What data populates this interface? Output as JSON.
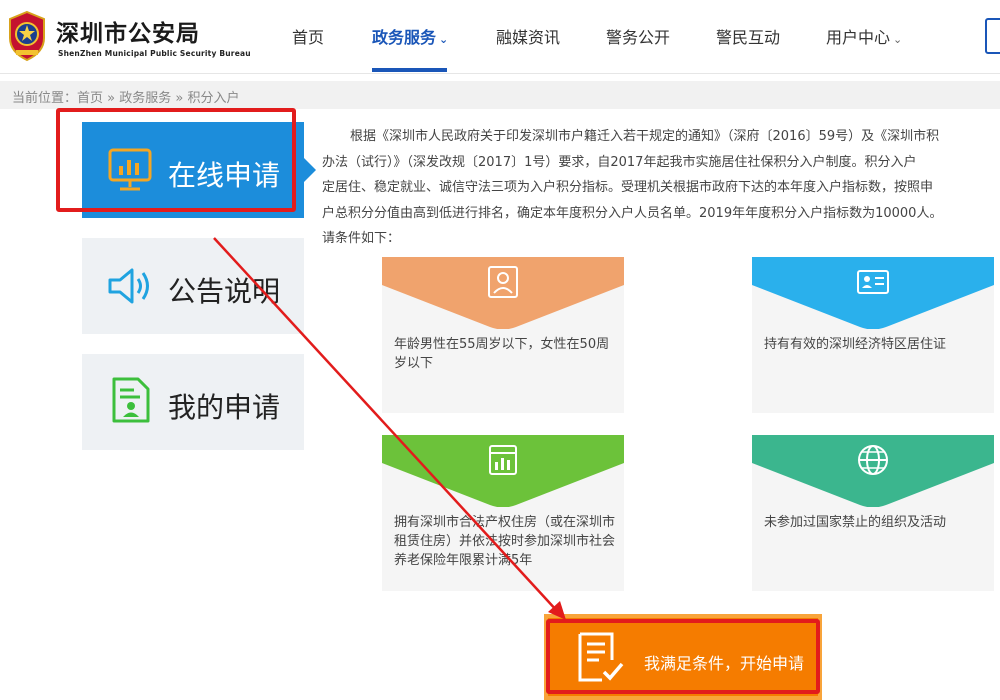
{
  "header": {
    "logo_title": "深圳市公安局",
    "logo_subtitle": "ShenZhen Municipal Public Security Bureau",
    "nav": [
      {
        "label": "首页"
      },
      {
        "label": "政务服务",
        "active": true
      },
      {
        "label": "融媒资讯"
      },
      {
        "label": "警务公开"
      },
      {
        "label": "警民互动"
      },
      {
        "label": "用户中心"
      }
    ]
  },
  "breadcrumb": {
    "prefix": "当前位置：",
    "items": [
      "首页",
      "政务服务",
      "积分入户"
    ],
    "separator": " » "
  },
  "sidebar": {
    "items": [
      {
        "label": "在线申请",
        "icon": "presentation-chart-icon",
        "active": true
      },
      {
        "label": "公告说明",
        "icon": "speaker-icon"
      },
      {
        "label": "我的申请",
        "icon": "document-user-icon"
      }
    ]
  },
  "intro": {
    "lines": [
      "根据《深圳市人民政府关于印发深圳市户籍迁入若干规定的通知》（深府〔2016〕59号）及《深圳市积",
      "办法（试行）》（深发改规〔2017〕1号）要求，自2017年起我市实施居住社保积分入户制度。积分入户",
      "定居住、稳定就业、诚信守法三项为入户积分指标。受理机关根据市政府下达的本年度入户指标数，按照申",
      "户总积分分值由高到低进行排名，确定本年度积分入户人员名单。2019年年度积分入户指标数为10000人。",
      "请条件如下："
    ]
  },
  "cards": [
    {
      "text": "年龄男性在55周岁以下，女性在50周岁以下",
      "color": "#f0a36d",
      "icon": "user-portrait-icon"
    },
    {
      "text": "持有有效的深圳经济特区居住证",
      "color": "#2ab0ec",
      "icon": "id-card-icon"
    },
    {
      "text": "拥有深圳市合法产权住房（或在深圳市租赁住房）并依法按时参加深圳市社会养老保险年限累计满5年",
      "color": "#6cc23a",
      "icon": "building-icon"
    },
    {
      "text": "未参加过国家禁止的组织及活动",
      "color": "#3bb68e",
      "icon": "globe-icon"
    }
  ],
  "cta": {
    "label": "我满足条件，开始申请",
    "icon": "form-check-icon",
    "color": "#f57c00"
  },
  "colors": {
    "brand_blue": "#1a56b8",
    "sidebar_active": "#1c8ddb",
    "annotation_red": "#e21c1c"
  }
}
